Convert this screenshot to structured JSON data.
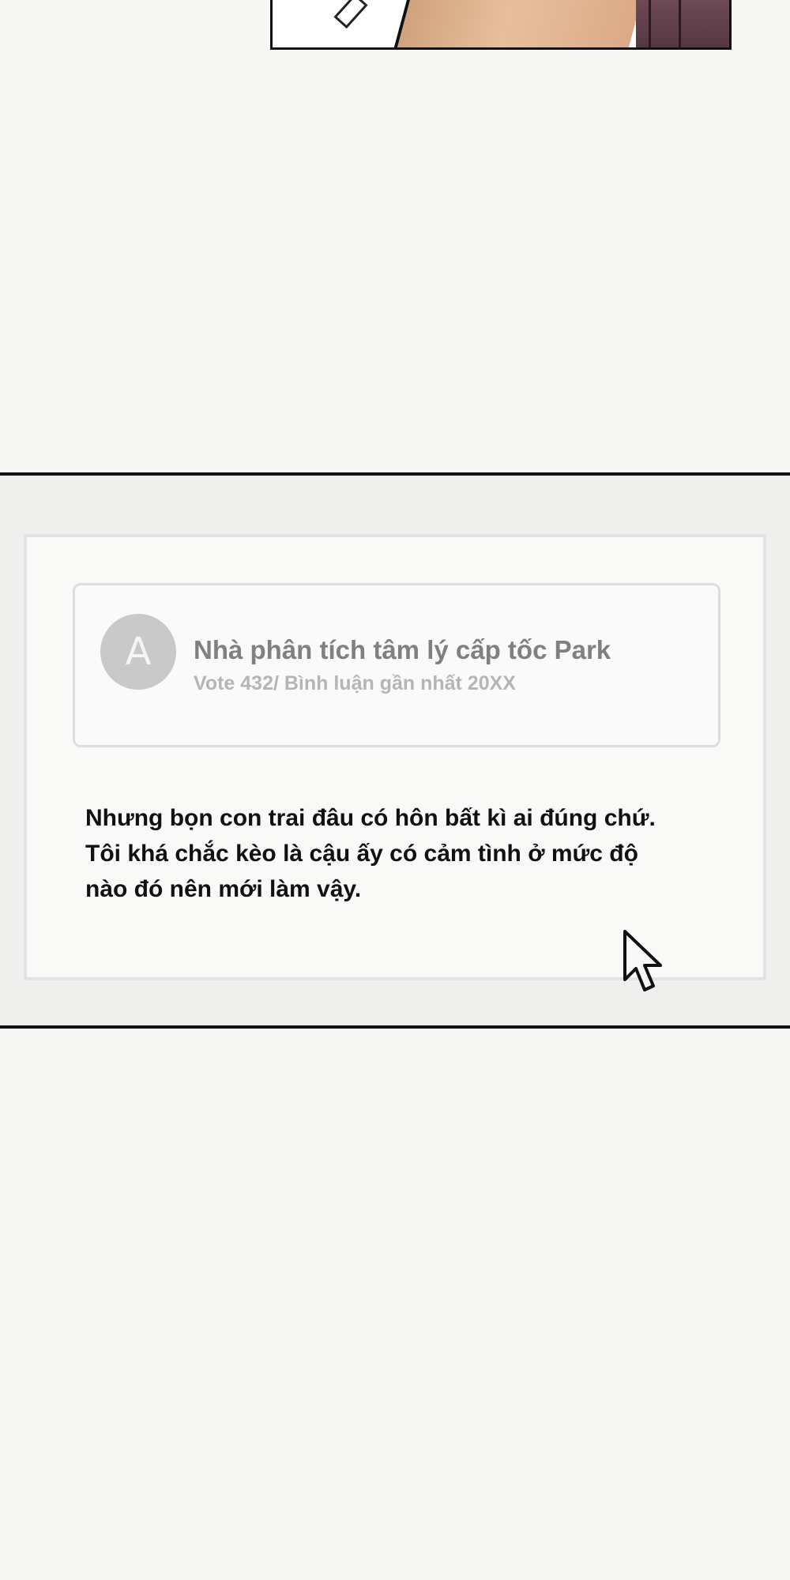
{
  "comment": {
    "avatar_letter": "A",
    "author_name": "Nhà phân tích tâm lý cấp tốc Park",
    "meta": "Vote 432/ Bình luận gần nhất 20XX",
    "body_lines": [
      "Nhưng bọn con trai đâu có hôn bất kì ai đúng chứ.",
      "Tôi khá chắc kèo là cậu ấy có cảm tình ở mức độ",
      "nào đó nên mới làm vậy."
    ]
  },
  "icons": {
    "cursor": "mouse-pointer-icon"
  }
}
